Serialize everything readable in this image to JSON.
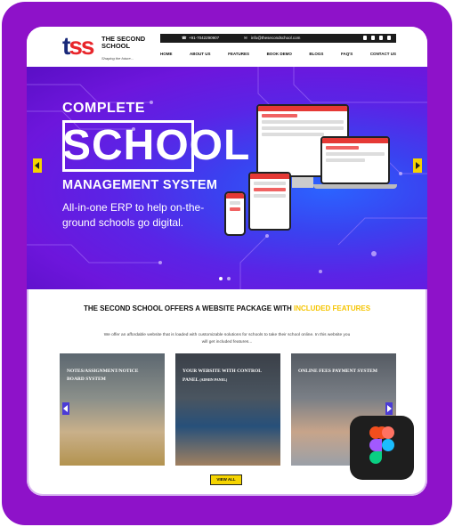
{
  "brand": {
    "logo_letters": "tss",
    "name": "THE SECOND SCHOOL",
    "tagline": "Shaping the future..."
  },
  "topbar": {
    "phone": "+91-7042290907",
    "email": "info@thesecondschool.com",
    "social_icons": [
      "facebook-icon",
      "twitter-icon",
      "instagram-icon",
      "linkedin-icon"
    ]
  },
  "nav": [
    "HOME",
    "ABOUT US",
    "FEATURES",
    "BOOK DEMO",
    "BLOGS",
    "FAQ'S",
    "CONTACT US"
  ],
  "hero": {
    "line1": "COMPLETE",
    "line2": "SCHOOL",
    "line3": "MANAGEMENT SYSTEM",
    "subtitle": "All-in-one ERP to help on-the-ground schools go digital."
  },
  "section": {
    "title_main": "THE SECOND SCHOOL OFFERS A WEBSITE PACKAGE WITH ",
    "title_highlight": "INCLUDED FEATURES",
    "description": "We offer an affordable website that is loaded with customizable solutions for schools to take their school online. In this website you will get included features..."
  },
  "cards": [
    {
      "title": "NOTES/ASSIGNMENT/NOTICE BOARD SYSTEM",
      "note": ""
    },
    {
      "title": "YOUR WEBSITE WITH CONTROL PANEL",
      "note": "(Admin Panel)"
    },
    {
      "title": "ONLINE FEES PAYMENT SYSTEM",
      "note": ""
    }
  ],
  "cta": {
    "label": "VIEW ALL"
  },
  "colors": {
    "frame": "#8e12c9",
    "accent_yellow": "#f5d400",
    "brand_red": "#e8262b",
    "brand_navy": "#1a2a7a"
  }
}
